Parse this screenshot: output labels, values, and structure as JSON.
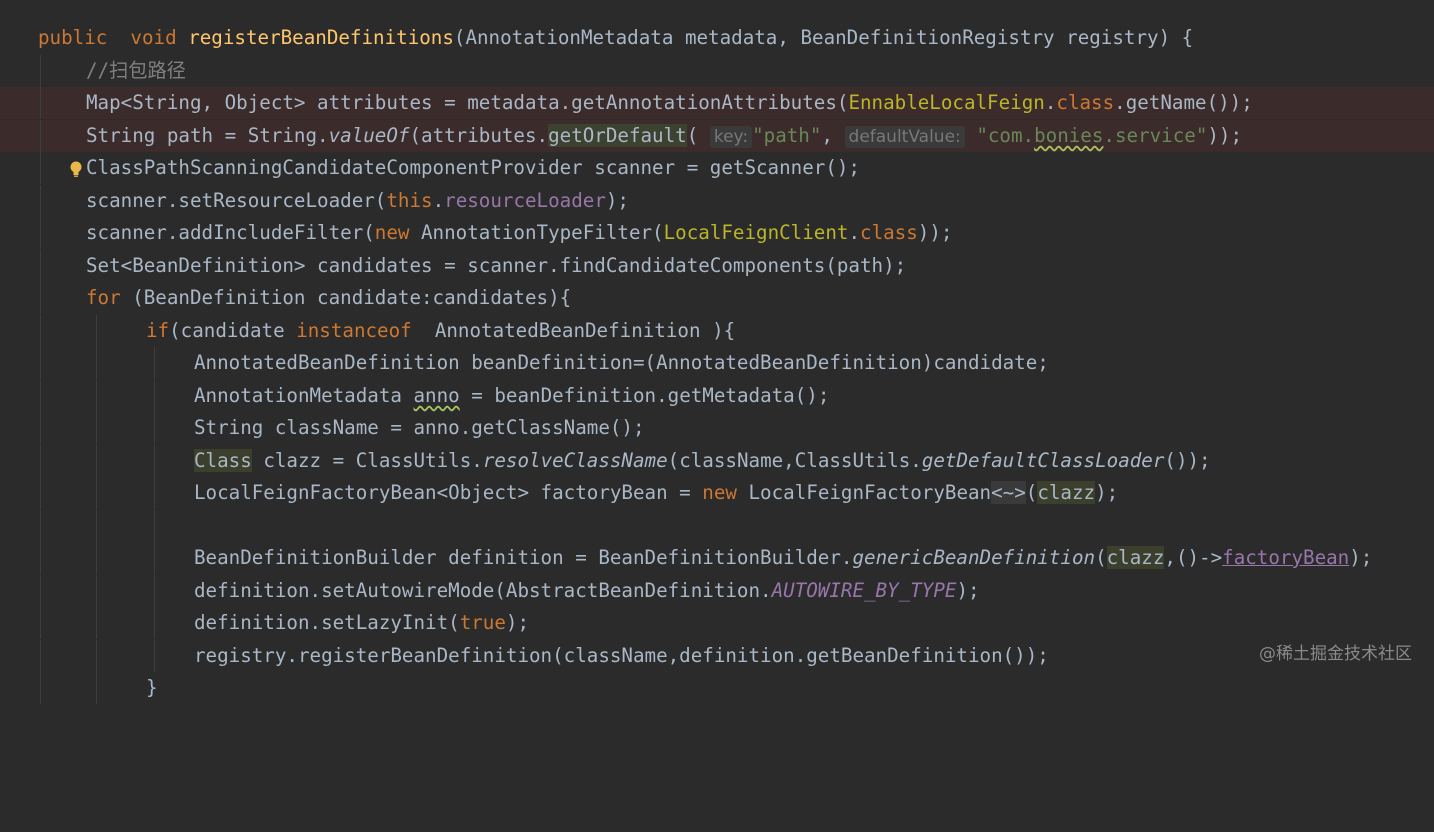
{
  "tokens": {
    "public": "public",
    "void": "void",
    "method": "registerBeanDefinitions",
    "sig_rest": "(AnnotationMetadata metadata, BeanDefinitionRegistry registry) {",
    "comment": "//扫包路径",
    "map_decl": "Map<String, Object> attributes = metadata.getAnnotationAttributes(",
    "enable_ann": "EnnableLocalFeign",
    "dot": ".",
    "class_kw": "class",
    "getname_end": ".getName());",
    "str_path_decl": "String path = String.",
    "valueOf": "valueOf",
    "attr_get": "(attributes.",
    "getOrDefault": "getOrDefault",
    "open_paren": "(",
    "hint_key": "key:",
    "str_path": "\"path\"",
    "comma": ",",
    "hint_default": "defaultValue:",
    "str_com1": "\"com.",
    "str_bonies": "bonies",
    "str_com2": ".service\"",
    "close_end": "));",
    "scanner_decl": "ClassPathScanningCandidateComponentProvider scanner = getScanner();",
    "set_loader1": "scanner.setResourceLoader(",
    "this_kw": "this",
    "resourceLoader": "resourceLoader",
    "set_loader2": ");",
    "add_filter1": "scanner.addIncludeFilter(",
    "new_kw": "new",
    "add_filter2": " AnnotationTypeFilter(",
    "local_client": "LocalFeignClient",
    "add_filter3": "));",
    "set_cand": "Set<BeanDefinition> candidates = scanner.findCandidateComponents(path);",
    "for_kw": "for",
    "for_rest": " (BeanDefinition candidate:candidates){",
    "if_kw": "if",
    "if_mid": "(candidate ",
    "instanceof_kw": "instanceof",
    "if_rest": "  AnnotatedBeanDefinition ){",
    "abd_decl": "AnnotatedBeanDefinition beanDefinition=(AnnotatedBeanDefinition)candidate;",
    "anno_decl1": "AnnotationMetadata ",
    "anno_var": "anno",
    "anno_decl2": " = beanDefinition.getMetadata();",
    "classname_decl": "String className = anno.getClassName();",
    "class_type": "Class",
    "clazz_decl1": " clazz = ClassUtils.",
    "resolveClassName": "resolveClassName",
    "clazz_decl2": "(className,ClassUtils.",
    "getDefaultClassLoader": "getDefaultClassLoader",
    "clazz_decl3": "());",
    "factory_decl1": "LocalFeignFactoryBean<Object> factoryBean = ",
    "factory_decl2": " LocalFeignFactoryBean",
    "diamond": "<~>",
    "clazz": "clazz",
    "factory_end": ");",
    "builder_decl": "BeanDefinitionBuilder definition = BeanDefinitionBuilder.",
    "genericBeanDefinition": "genericBeanDefinition",
    "builder_mid": ",()->",
    "factoryBean": "factoryBean",
    "autowire1": "definition.setAutowireMode(AbstractBeanDefinition.",
    "autowire_const": "AUTOWIRE_BY_TYPE",
    "lazy1": "definition.setLazyInit(",
    "true_kw": "true",
    "register": "registry.registerBeanDefinition(className,definition.getBeanDefinition());",
    "close_brace": "}"
  },
  "watermark": "@稀土掘金技术社区",
  "gutter": {
    "bulb_icon": "lightbulb-icon"
  },
  "colors": {
    "background": "#2b2b2b",
    "keyword": "#cc7832",
    "method": "#ffc66d",
    "string": "#6a8759",
    "field": "#9876aa",
    "annotation": "#bbb529",
    "comment": "#808080"
  }
}
